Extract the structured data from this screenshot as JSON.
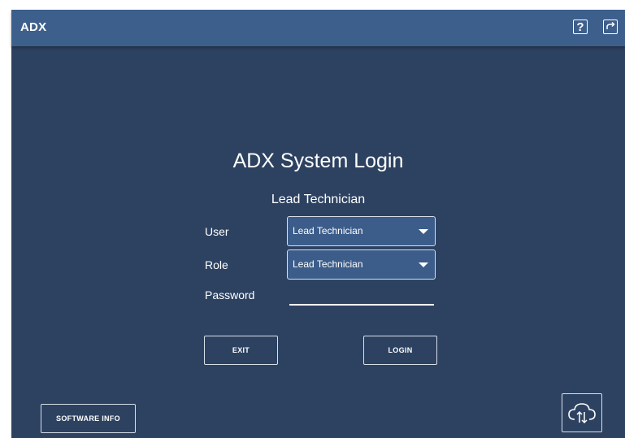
{
  "app": {
    "title": "ADX"
  },
  "topbar": {
    "help_icon": "help-icon",
    "share_icon": "share-export-icon",
    "help_glyph": "?"
  },
  "login": {
    "title": "ADX System Login",
    "current_role": "Lead Technician",
    "user_label": "User",
    "user_value": "Lead Technician",
    "role_label": "Role",
    "role_value": "Lead Technician",
    "password_label": "Password",
    "password_value": "",
    "exit_label": "EXIT",
    "login_label": "LOGIN"
  },
  "footer": {
    "software_info_label": "SOFTWARE INFO",
    "cloud_icon": "cloud-sync-icon"
  },
  "colors": {
    "background": "#2d4261",
    "topbar": "#3d5f8c",
    "select": "#3c5d8a"
  }
}
